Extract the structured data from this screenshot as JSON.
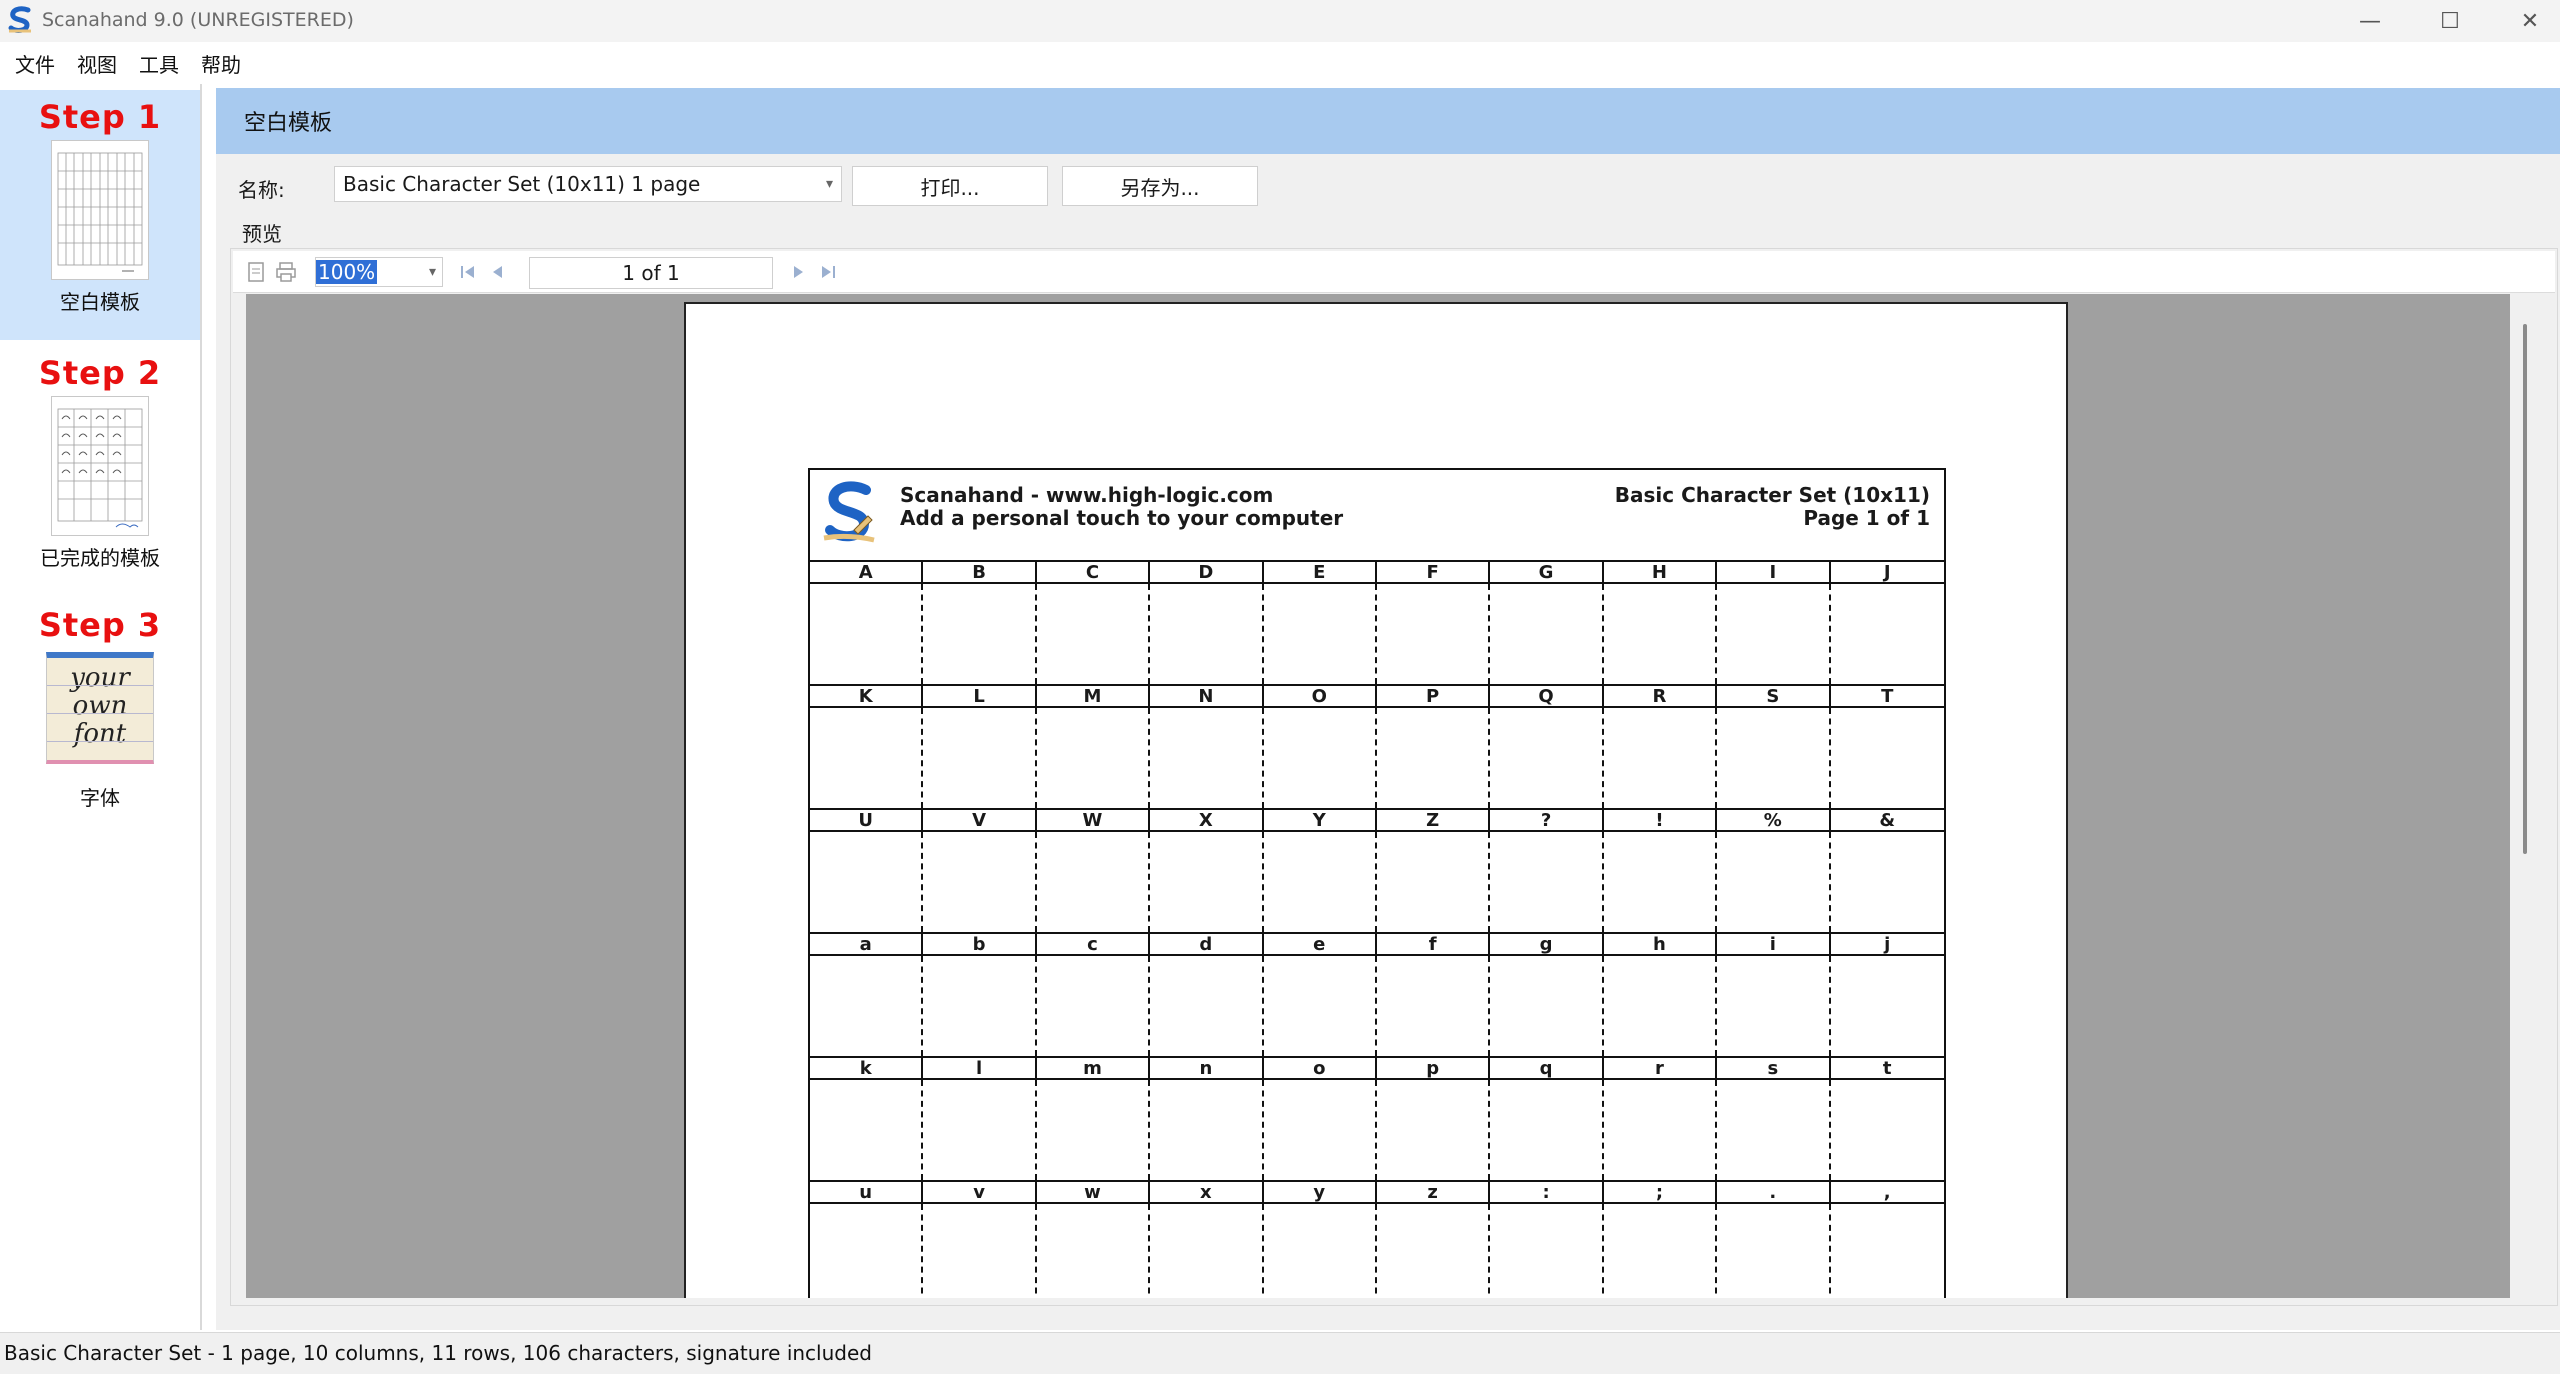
{
  "window": {
    "title": "Scanahand 9.0 (UNREGISTERED)",
    "controls": {
      "minimize": "—",
      "maximize": "☐",
      "close": "✕"
    }
  },
  "menu": [
    "文件",
    "视图",
    "工具",
    "帮助"
  ],
  "sidebar": {
    "steps": [
      {
        "title": "Step 1",
        "label": "空白模板",
        "active": true
      },
      {
        "title": "Step 2",
        "label": "已完成的模板",
        "active": false
      },
      {
        "title": "Step 3",
        "label": "字体",
        "active": false,
        "thumb_text": [
          "your",
          "own",
          "font"
        ]
      }
    ]
  },
  "main": {
    "banner_title": "空白模板",
    "name_label": "名称:",
    "template_name": "Basic Character Set (10x11) 1 page",
    "print_button": "打印...",
    "save_as_button": "另存为...",
    "preview_label": "预览"
  },
  "preview_toolbar": {
    "zoom": "100%",
    "page_indicator": "1 of 1"
  },
  "sheet": {
    "header_left_1": "Scanahand - www.high-logic.com",
    "header_left_2": "Add a personal touch to your computer",
    "header_right_1": "Basic Character Set (10x11)",
    "header_right_2": "Page 1 of 1",
    "rows": [
      [
        "A",
        "B",
        "C",
        "D",
        "E",
        "F",
        "G",
        "H",
        "I",
        "J"
      ],
      [
        "K",
        "L",
        "M",
        "N",
        "O",
        "P",
        "Q",
        "R",
        "S",
        "T"
      ],
      [
        "U",
        "V",
        "W",
        "X",
        "Y",
        "Z",
        "?",
        "!",
        "%",
        "&"
      ],
      [
        "a",
        "b",
        "c",
        "d",
        "e",
        "f",
        "g",
        "h",
        "i",
        "j"
      ],
      [
        "k",
        "l",
        "m",
        "n",
        "o",
        "p",
        "q",
        "r",
        "s",
        "t"
      ],
      [
        "u",
        "v",
        "w",
        "x",
        "y",
        "z",
        ":",
        ";",
        ".",
        ","
      ]
    ]
  },
  "status": "Basic Character Set - 1 page, 10 columns, 11 rows, 106 characters, signature included"
}
